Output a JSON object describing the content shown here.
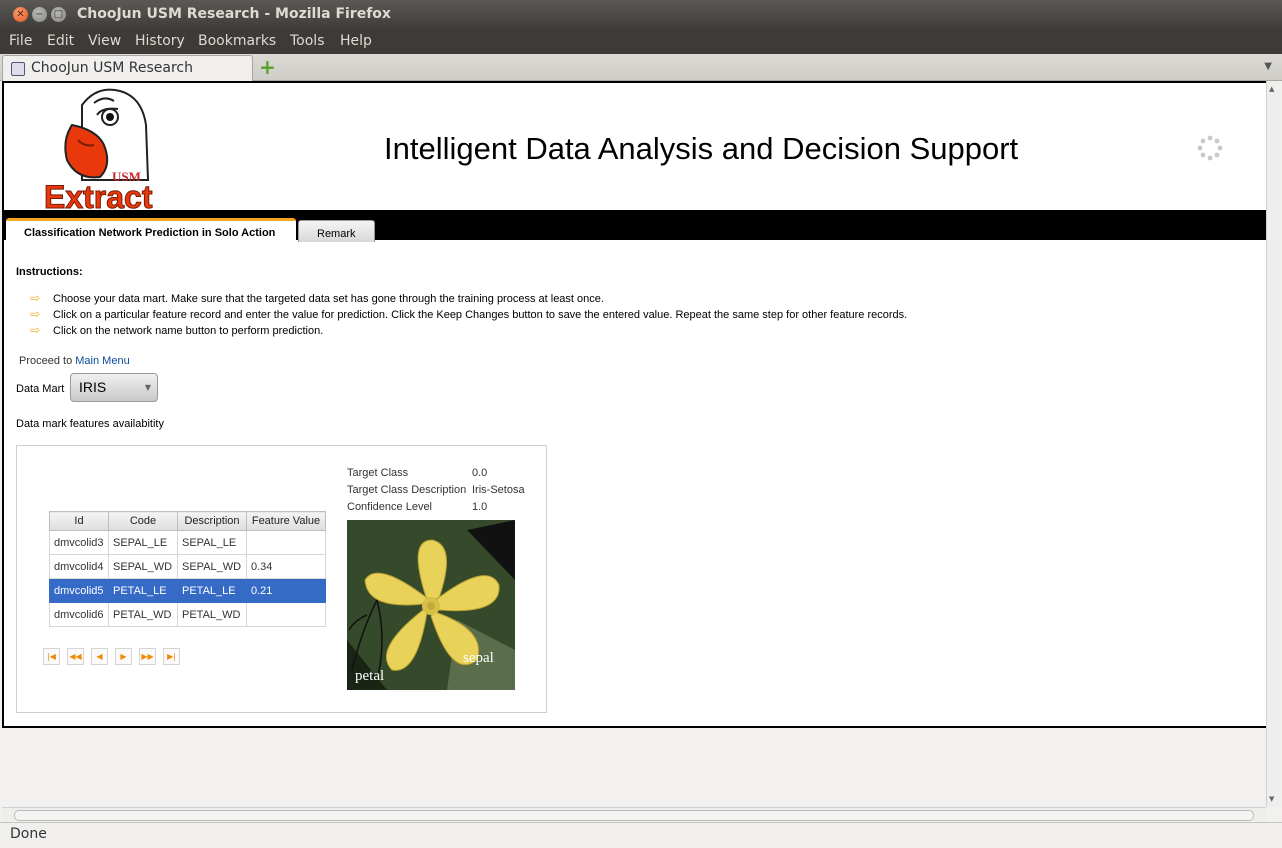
{
  "window": {
    "title": "ChooJun USM Research - Mozilla Firefox"
  },
  "menubar": {
    "items": [
      "File",
      "Edit",
      "View",
      "History",
      "Bookmarks",
      "Tools",
      "Help"
    ]
  },
  "browser_tab": {
    "label": "ChooJun USM Research"
  },
  "banner": {
    "title": "Intelligent Data Analysis and Decision Support",
    "logo_text": "Extract",
    "logo_badge": "USM"
  },
  "tabs": [
    {
      "label": "Classification Network Prediction in Solo Action",
      "active": true
    },
    {
      "label": "Remark",
      "active": false
    }
  ],
  "instructions": {
    "heading": "Instructions:",
    "items": [
      "Choose your data mart. Make sure that the targeted data set has gone through the training process at least once.",
      "Click on a particular feature record and enter the value for prediction. Click the Keep Changes button to save the entered value. Repeat the same step for other feature records.",
      "Click on the network name button to perform prediction."
    ]
  },
  "proceed": {
    "prefix": "Proceed to",
    "link": "Main Menu"
  },
  "data_mart": {
    "label": "Data Mart",
    "selected": "IRIS"
  },
  "features_label": "Data mark features availabitity",
  "table": {
    "columns": [
      "Id",
      "Code",
      "Description",
      "Feature Value"
    ],
    "rows": [
      [
        "dmvcolid3",
        "SEPAL_LE",
        "SEPAL_LE",
        ""
      ],
      [
        "dmvcolid4",
        "SEPAL_WD",
        "SEPAL_WD",
        "0.34"
      ],
      [
        "dmvcolid5",
        "PETAL_LE",
        "PETAL_LE",
        "0.21"
      ],
      [
        "dmvcolid6",
        "PETAL_WD",
        "PETAL_WD",
        ""
      ]
    ],
    "selected_row": 2
  },
  "result": {
    "target_class_label": "Target Class",
    "target_class": "0.0",
    "target_desc_label": "Target Class Description",
    "target_desc": "Iris-Setosa",
    "confidence_label": "Confidence Level",
    "confidence": "1.0"
  },
  "flower_image": {
    "petal_label": "petal",
    "sepal_label": "sepal"
  },
  "status": "Done",
  "colors": {
    "tab_accent": "#f5a623",
    "selection": "#356bc7",
    "link": "#0b4a9a"
  }
}
